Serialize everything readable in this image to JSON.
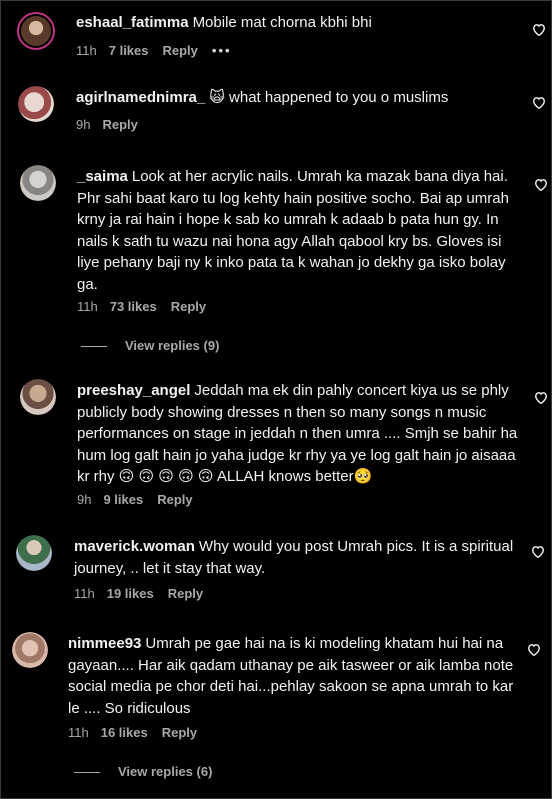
{
  "comments": [
    {
      "username": "eshaal_fatimma",
      "text": "Mobile mat chorna kbhi bhi",
      "time": "11h",
      "likes": "7 likes",
      "reply": "Reply",
      "more": "•••"
    },
    {
      "username": "agirlnamednimra_",
      "text": "🙀 what happened to you o muslims",
      "time": "9h",
      "reply": "Reply"
    },
    {
      "username": "_saima",
      "text": "Look at her acrylic nails. Umrah ka mazak bana diya hai. Phr sahi baat karo tu log kehty hain positive socho. Bai ap umrah krny ja rai hain i hope k sab ko umrah k adaab b pata hun gy. In nails k sath tu wazu nai hona agy Allah qabool kry bs. Gloves isi liye pehany baji ny k inko pata ta k wahan jo dekhy ga isko bolay ga.",
      "time": "11h",
      "likes": "73 likes",
      "reply": "Reply",
      "view_replies": "View replies (9)"
    },
    {
      "username": "preeshay_angel",
      "text": "Jeddah ma ek din pahly concert kiya us se phly publicly body showing dresses n then so many songs n music performances on stage in jeddah n then umra .... Smjh se bahir ha hum log galt hain jo yaha judge kr rhy ya ye log galt hain jo aisaaa kr rhy 🙃 🙃 🙃 🙃 🙃 ALLAH knows better🥺",
      "time": "9h",
      "likes": "9 likes",
      "reply": "Reply"
    },
    {
      "username": "maverick.woman",
      "text": "Why would you post Umrah pics. It is a spiritual journey, .. let it stay that way.",
      "time": "11h",
      "likes": "19 likes",
      "reply": "Reply"
    },
    {
      "username": "nimmee93",
      "text": "Umrah pe gae hai na is ki modeling khatam hui hai na gayaan.... Har aik qadam uthanay pe aik tasweer or aik lamba note social media pe chor deti hai...pehlay sakoon se apna umrah to kar le .... So ridiculous",
      "time": "11h",
      "likes": "16 likes",
      "reply": "Reply",
      "view_replies": "View replies (6)"
    }
  ],
  "colors": {
    "background": "#000000",
    "text": "#f2f2f2",
    "muted": "#a8a8a8",
    "story_ring": "#c13584"
  }
}
